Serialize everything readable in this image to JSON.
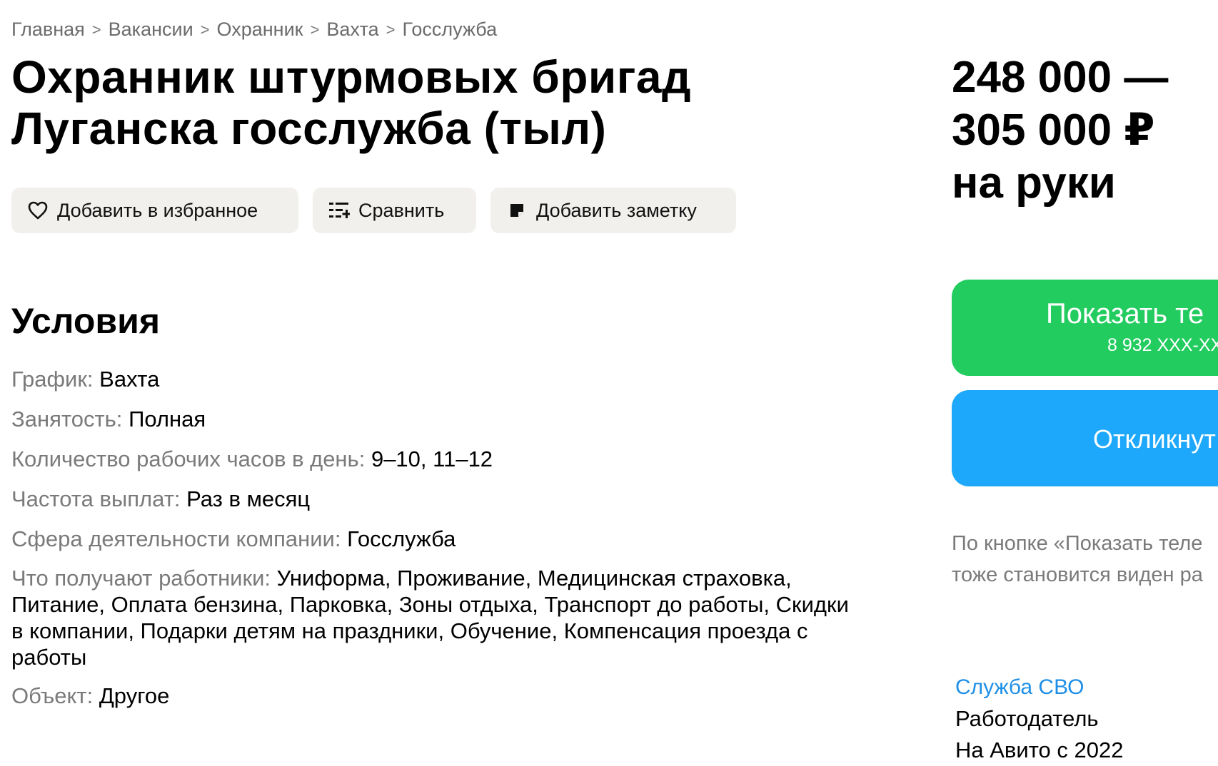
{
  "breadcrumb": {
    "items": [
      "Главная",
      "Вакансии",
      "Охранник",
      "Вахта",
      "Госслужба"
    ],
    "separator": ">"
  },
  "vacancy": {
    "title_line1": "Охранник штурмовых бригад",
    "title_line2": "Луганска госслужба (тыл)"
  },
  "actions": {
    "favorite_label": "Добавить в избранное",
    "compare_label": "Сравнить",
    "note_label": "Добавить заметку"
  },
  "salary": {
    "line1": "248 000 —",
    "line2": "305 000 ₽",
    "line3": "на руки"
  },
  "conditions": {
    "heading": "Условия",
    "rows": [
      {
        "label": "График:",
        "value": "Вахта"
      },
      {
        "label": "Занятость:",
        "value": "Полная"
      },
      {
        "label": "Количество рабочих часов в день:",
        "value": "9–10, 11–12"
      },
      {
        "label": "Частота выплат:",
        "value": "Раз в месяц"
      },
      {
        "label": "Сфера деятельности компании:",
        "value": "Госслужба"
      },
      {
        "label": "Что получают работники:",
        "value": "Униформа, Проживание, Медицинская страховка, Питание, Оплата бензина, Парковка, Зоны отдыха, Транспорт до работы, Скидки в компании, Подарки детям на праздники, Обучение, Компенсация проезда с работы"
      },
      {
        "label": "Объект:",
        "value": "Другое"
      }
    ]
  },
  "contact": {
    "show_phone_label": "Показать те",
    "phone_masked": "8 932 XXX-XX",
    "respond_label": "Откликнут",
    "hint_line1": "По кнопке «Показать теле",
    "hint_line2": "тоже становится виден ра"
  },
  "employer": {
    "name": "Служба СВО",
    "role": "Работодатель",
    "since": "На Авито с 2022"
  },
  "colors": {
    "green_button": "#22cc5f",
    "blue_button": "#1ea8fb",
    "employer_link": "#1e8fe6",
    "action_bg": "#f2f0ec",
    "muted_text": "#7a7a7a"
  },
  "icons": {
    "favorite": "heart-icon",
    "compare": "compare-list-icon",
    "note": "note-icon"
  }
}
